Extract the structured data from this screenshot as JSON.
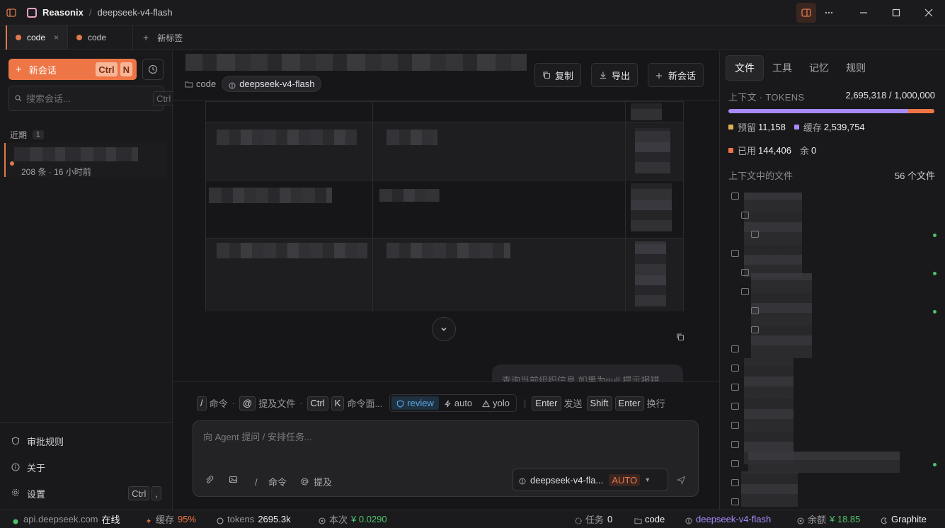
{
  "titlebar": {
    "app_name": "Reasonix",
    "separator": "/",
    "session_title": "deepseek-v4-flash"
  },
  "tabs": [
    {
      "label": "code",
      "active": true,
      "close": "×"
    },
    {
      "label": "code",
      "active": false
    }
  ],
  "new_tab_label": "新标签",
  "sidebar": {
    "new_chat_label": "新会话",
    "new_chat_keys": [
      "Ctrl",
      "N"
    ],
    "search_placeholder": "搜索会话...",
    "search_keys": [
      "Ctrl",
      "K"
    ],
    "recent_label": "近期",
    "recent_count": "1",
    "session_meta": "208 条 · 16 小时前",
    "bottom": {
      "approval_rules": "审批规则",
      "about": "关于",
      "settings": "设置",
      "settings_keys": [
        "Ctrl",
        ","
      ]
    }
  },
  "main": {
    "crumb_folder": "code",
    "model_pill": "deepseek-v4-flash",
    "buttons": {
      "copy": "复制",
      "export": "导出",
      "new_chat": "新会话"
    },
    "user_message": "查询当前组织信息,如果为null 提示报错"
  },
  "composer": {
    "hints": {
      "slash": "/",
      "slash_label": "命令",
      "at": "@",
      "at_label": "提及文件",
      "palette_keys": [
        "Ctrl",
        "K"
      ],
      "palette_label": "命令面...",
      "enter": "Enter",
      "enter_label": "发送",
      "shift": "Shift",
      "enter2": "Enter",
      "newline_label": "换行"
    },
    "modes": [
      {
        "label": "review",
        "active": true
      },
      {
        "label": "auto",
        "active": false
      },
      {
        "label": "yolo",
        "active": false
      }
    ],
    "placeholder": "向 Agent 提问 / 安排任务...",
    "tool_command": "命令",
    "tool_mention": "提及",
    "tool_slash": "/",
    "model": "deepseek-v4-fla...",
    "auto_badge": "AUTO"
  },
  "right_panel": {
    "tabs": [
      {
        "label": "文件",
        "active": true
      },
      {
        "label": "工具",
        "active": false
      },
      {
        "label": "记忆",
        "active": false
      },
      {
        "label": "规则",
        "active": false
      }
    ],
    "context_label": "上下文 · TOKENS",
    "context_value": "2,695,318 / 1,000,000",
    "context_bar": {
      "cache_fraction": 0.873,
      "used_fraction": 0.127
    },
    "legend": {
      "reserved_label": "预留",
      "reserved_value": "11,158",
      "cache_label": "缓存",
      "cache_value": "2,539,754",
      "used_label": "已用",
      "used_value": "144,406",
      "remaining_label": "余",
      "remaining_value": "0"
    },
    "files_label": "上下文中的文件",
    "files_count": "56 个文件"
  },
  "statusbar": {
    "endpoint": "api.deepseek.com",
    "online": "在线",
    "cache_label": "缓存",
    "cache_value": "95%",
    "tokens_label": "tokens",
    "tokens_value": "2695.3k",
    "cost_label": "本次",
    "cost_value": "¥ 0.0290",
    "tasks_label": "任务",
    "tasks_value": "0",
    "folder": "code",
    "model": "deepseek-v4-flash",
    "balance_label": "余额",
    "balance_value": "¥ 18.85",
    "theme": "Graphite"
  },
  "colors": {
    "accent": "#ee7646",
    "review_blue": "#5aa8e6",
    "cache_purple": "#a78bfa",
    "reserved_yellow": "#e0b050",
    "used_orange": "#ee7646",
    "online_green": "#4ec46a",
    "model_purple": "#a78bfa"
  }
}
